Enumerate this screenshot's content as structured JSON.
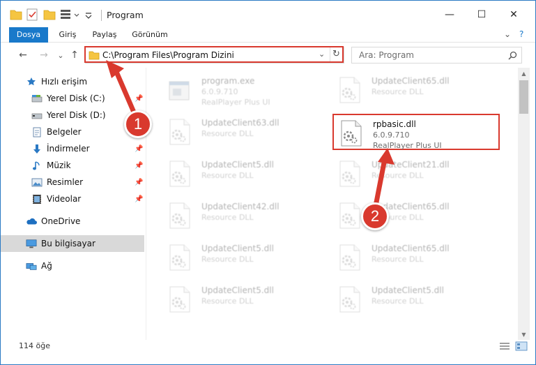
{
  "window": {
    "title": "Program",
    "controls": {
      "minimize": "—",
      "maximize": "☐",
      "close": "✕"
    }
  },
  "ribbon": {
    "tabs": [
      {
        "label": "Dosya",
        "active": true
      },
      {
        "label": "Giriş",
        "active": false
      },
      {
        "label": "Paylaş",
        "active": false
      },
      {
        "label": "Görünüm",
        "active": false
      }
    ],
    "expand_icon": "⌄",
    "help_icon": "?"
  },
  "nav": {
    "back": "←",
    "forward": "→",
    "recent": "⌄",
    "up": "↑",
    "address": "C:\\Program Files\\Program Dizini",
    "search_placeholder": "Ara: Program"
  },
  "sidebar": {
    "items": [
      {
        "label": "Hızlı erişim",
        "icon": "star-icon",
        "pinned": false
      },
      {
        "label": "Yerel Disk (C:)",
        "icon": "drive-icon",
        "pinned": true
      },
      {
        "label": "Yerel Disk (D:)",
        "icon": "drive-icon",
        "pinned": true
      },
      {
        "label": "Belgeler",
        "icon": "document-icon",
        "pinned": true
      },
      {
        "label": "İndirmeler",
        "icon": "download-icon",
        "pinned": true
      },
      {
        "label": "Müzik",
        "icon": "music-icon",
        "pinned": true
      },
      {
        "label": "Resimler",
        "icon": "picture-icon",
        "pinned": true
      },
      {
        "label": "Videolar",
        "icon": "video-icon",
        "pinned": true
      },
      {
        "label": "OneDrive",
        "icon": "cloud-icon",
        "pinned": false
      },
      {
        "label": "Bu bilgisayar",
        "icon": "computer-icon",
        "pinned": false,
        "selected": true
      },
      {
        "label": "Ağ",
        "icon": "network-icon",
        "pinned": false
      }
    ]
  },
  "files": [
    {
      "name": "program.exe",
      "version": "6.0.9.710",
      "desc": "RealPlayer Plus UI",
      "faded": true,
      "type": "exe"
    },
    {
      "name": "UpdateClient65.dll",
      "version": "",
      "desc": "Resource DLL",
      "faded": true,
      "type": "dll"
    },
    {
      "name": "UpdateClient63.dll",
      "version": "",
      "desc": "Resource DLL",
      "faded": true,
      "type": "dll"
    },
    {
      "name": "rpbasic.dll",
      "version": "6.0.9.710",
      "desc": "RealPlayer Plus UI",
      "faded": false,
      "type": "dll"
    },
    {
      "name": "UpdateClient5.dll",
      "version": "",
      "desc": "Resource DLL",
      "faded": true,
      "type": "dll"
    },
    {
      "name": "UpdateClient21.dll",
      "version": "",
      "desc": "Resource DLL",
      "faded": true,
      "type": "dll"
    },
    {
      "name": "UpdateClient42.dll",
      "version": "",
      "desc": "Resource DLL",
      "faded": true,
      "type": "dll"
    },
    {
      "name": "UpdateClient65.dll",
      "version": "",
      "desc": "Resource DLL",
      "faded": true,
      "type": "dll"
    },
    {
      "name": "UpdateClient5.dll",
      "version": "",
      "desc": "Resource DLL",
      "faded": true,
      "type": "dll"
    },
    {
      "name": "UpdateClient65.dll",
      "version": "",
      "desc": "Resource DLL",
      "faded": true,
      "type": "dll"
    },
    {
      "name": "UpdateClient5.dll",
      "version": "",
      "desc": "Resource DLL",
      "faded": true,
      "type": "dll"
    },
    {
      "name": "UpdateClient5.dll",
      "version": "",
      "desc": "Resource DLL",
      "faded": true,
      "type": "dll"
    }
  ],
  "status": {
    "count": "114 öğe"
  },
  "annotations": {
    "badge1": "1",
    "badge2": "2",
    "color": "#d9392e"
  }
}
